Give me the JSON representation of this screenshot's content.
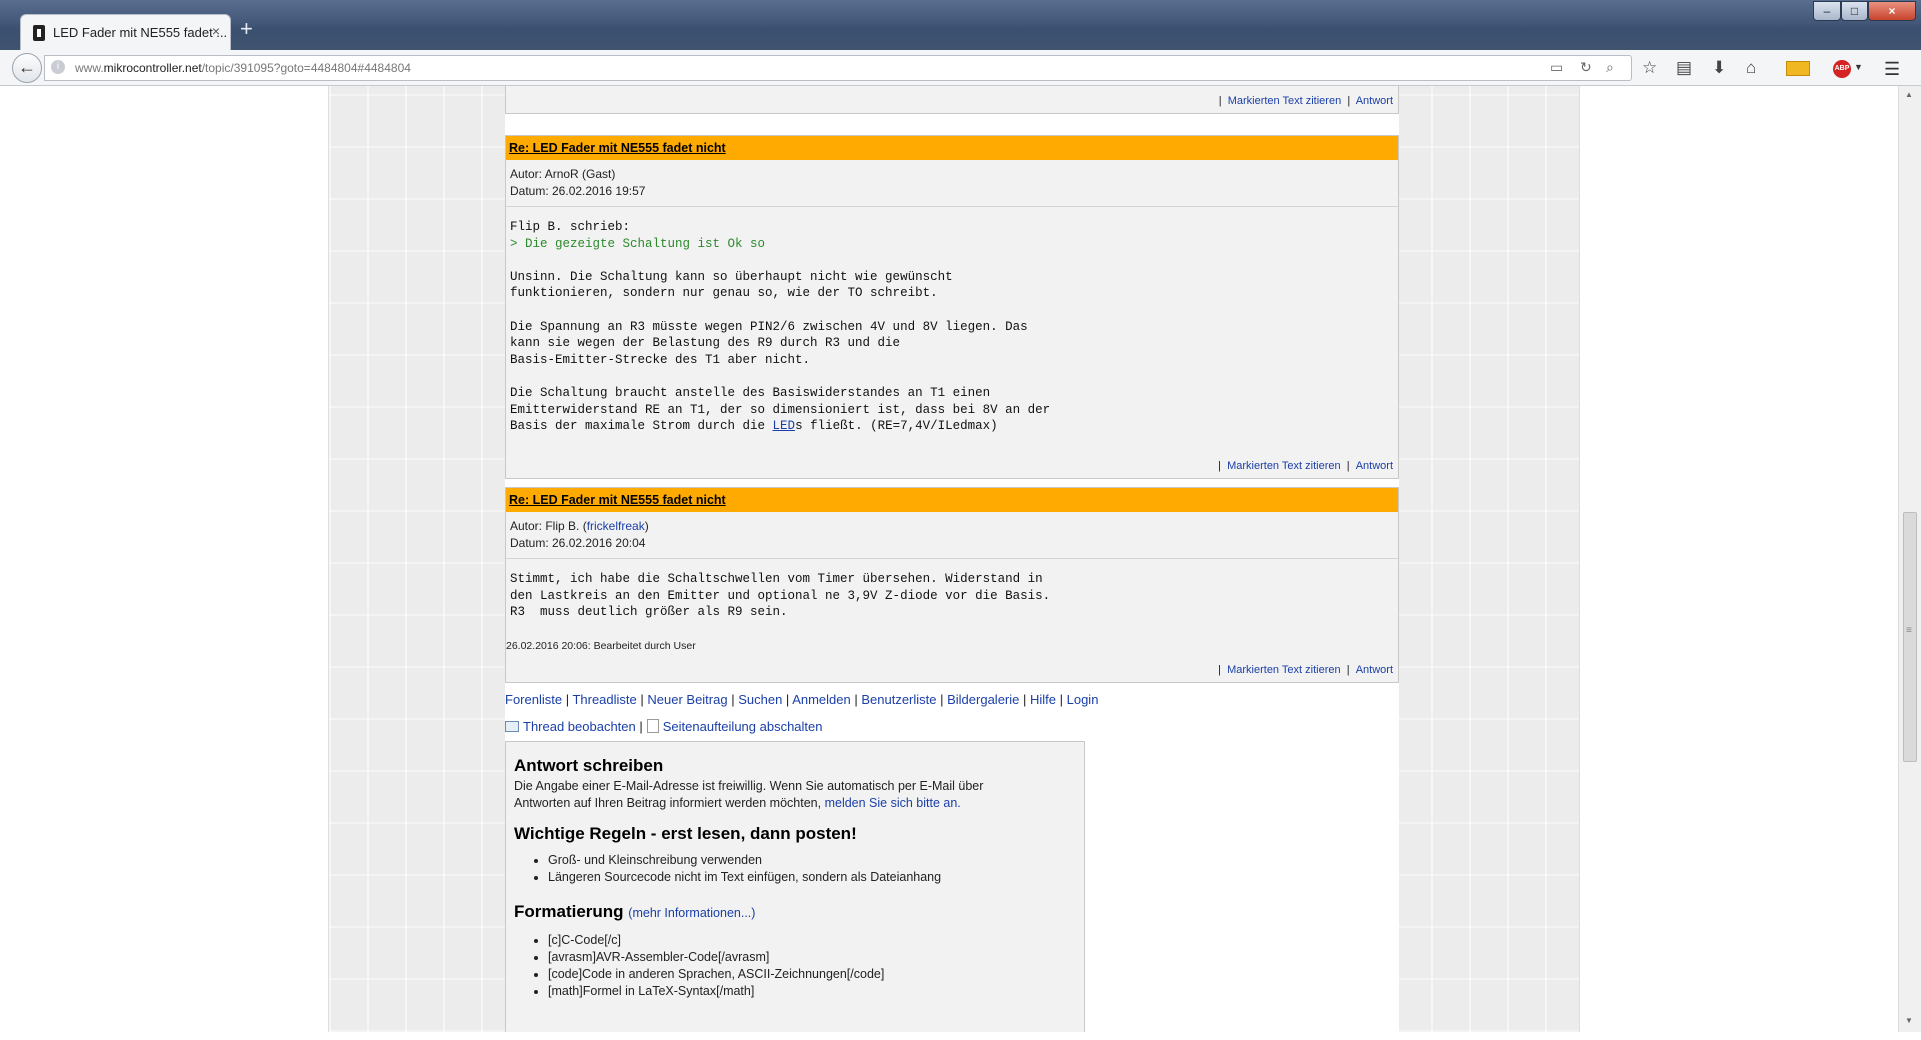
{
  "browser": {
    "tab_title": "LED Fader mit NE555 fadet ...",
    "tab_close": "×",
    "new_tab": "+",
    "url_prefix": "www.",
    "url_domain": "mikrocontroller.net",
    "url_path": "/topic/391095?goto=4484804#4484804",
    "win_min": "–",
    "win_max": "□",
    "win_close": "×"
  },
  "posts": [
    {
      "footer_sep1": "|",
      "footer_quote": "Markierten Text zitieren",
      "footer_sep2": "|",
      "footer_reply": "Antwort"
    },
    {
      "title": "Re: LED Fader mit NE555 fadet nicht",
      "author": "Autor: ArnoR (Gast)",
      "date": "Datum: 26.02.2016 19:57",
      "quote_intro": "Flip B. schrieb:",
      "quote_line": "> Die gezeigte Schaltung ist Ok so",
      "body_1": "Unsinn. Die Schaltung kann so überhaupt nicht wie gewünscht\nfunktionieren, sondern nur genau so, wie der TO schreibt.\n\nDie Spannung an R3 müsste wegen PIN2/6 zwischen 4V und 8V liegen. Das\nkann sie wegen der Belastung des R9 durch R3 und die\nBasis-Emitter-Strecke des T1 aber nicht.\n\nDie Schaltung braucht anstelle des Basiswiderstandes an T1 einen\nEmitterwiderstand RE an T1, der so dimensioniert ist, dass bei 8V an der\nBasis der maximale Strom durch die ",
      "body_link": "LED",
      "body_2": "s fließt. (RE=7,4V/ILedmax)",
      "footer_quote": "Markierten Text zitieren",
      "footer_reply": "Antwort"
    },
    {
      "title": "Re: LED Fader mit NE555 fadet nicht",
      "author_prefix": "Autor: Flip B. (",
      "author_link": "frickelfreak",
      "author_suffix": ")",
      "date": "Datum: 26.02.2016 20:04",
      "body": "Stimmt, ich habe die Schaltschwellen vom Timer übersehen. Widerstand in\nden Lastkreis an den Emitter und optional ne 3,9V Z-diode vor die Basis.\nR3  muss deutlich größer als R9 sein.",
      "edit_note": "26.02.2016 20:06: Bearbeitet durch User",
      "footer_quote": "Markierten Text zitieren",
      "footer_reply": "Antwort"
    }
  ],
  "forum_nav": [
    "Forenliste",
    "Threadliste",
    "Neuer Beitrag",
    "Suchen",
    "Anmelden",
    "Benutzerliste",
    "Bildergalerie",
    "Hilfe",
    "Login"
  ],
  "thread_links": {
    "watch": "Thread beobachten",
    "paging": "Seitenaufteilung abschalten"
  },
  "reply": {
    "heading": "Antwort schreiben",
    "intro": "Die Angabe einer E-Mail-Adresse ist freiwillig. Wenn Sie automatisch per E-Mail über Antworten auf Ihren Beitrag informiert werden möchten, ",
    "intro_link": "melden Sie sich bitte an.",
    "rules_heading": "Wichtige Regeln - erst lesen, dann posten!",
    "rules": [
      "Groß- und Kleinschreibung verwenden",
      "Längeren Sourcecode nicht im Text einfügen, sondern als Dateianhang"
    ],
    "format_heading": "Formatierung",
    "format_more": "(mehr Informationen...)",
    "format_items": [
      "[c]C-Code[/c]",
      "[avrasm]AVR-Assembler-Code[/avrasm]",
      "[code]Code in anderen Sprachen, ASCII-Zeichnungen[/code]",
      "[math]Formel in LaTeX-Syntax[/math]"
    ]
  },
  "icons": [
    "back-arrow-icon",
    "reload-icon",
    "search-icon",
    "bookmark-star-icon",
    "reading-list-icon",
    "download-icon",
    "home-icon",
    "mail-icon",
    "adblock-icon",
    "menu-icon"
  ],
  "colors": {
    "post_header": "#ffaa00",
    "link": "#1a3fa8",
    "quote": "#2a8a2a"
  }
}
